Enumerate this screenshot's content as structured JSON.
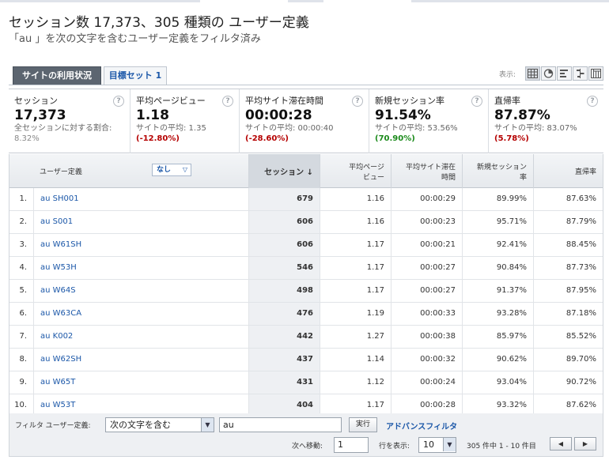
{
  "page": {
    "title": "セッション数 17,373、305 種類の ユーザー定義",
    "subtitle": "「au 」を次の文字を含むユーザー定義をフィルタ済み"
  },
  "tabs": [
    {
      "label": "サイトの利用状況",
      "active": true
    },
    {
      "label": "目標セット 1",
      "active": false
    }
  ],
  "views": {
    "label": "表示:",
    "icons": [
      "table-view-icon",
      "pie-view-icon",
      "performance-view-icon",
      "comparison-view-icon",
      "pivot-view-icon"
    ]
  },
  "scorecards": [
    {
      "label": "セッション",
      "value": "17,373",
      "sub": "全セッションに対する割合:",
      "delta": "8.32%",
      "delta_type": "plain"
    },
    {
      "label": "平均ページビュー",
      "value": "1.18",
      "sub": "サイトの平均: 1.35",
      "delta": "(-12.80%)",
      "delta_type": "neg"
    },
    {
      "label": "平均サイト滞在時間",
      "value": "00:00:28",
      "sub": "サイトの平均: 00:00:40",
      "delta": "(-28.60%)",
      "delta_type": "neg"
    },
    {
      "label": "新規セッション率",
      "value": "91.54%",
      "sub": "サイトの平均: 53.56%",
      "delta": "(70.90%)",
      "delta_type": "pos"
    },
    {
      "label": "直帰率",
      "value": "87.87%",
      "sub": "サイトの平均: 83.07%",
      "delta": "(5.78%)",
      "delta_type": "neg"
    }
  ],
  "table": {
    "dimension_label": "ユーザー定義",
    "segment_label": "なし",
    "headers": {
      "sessions": "セッション ↓",
      "pageviews": "平均ページ\nビュー",
      "duration": "平均サイト滞在\n時間",
      "new_rate": "新規セッション\n率",
      "bounce": "直帰率"
    },
    "rows": [
      {
        "idx": "1.",
        "name": "au SH001",
        "sessions": "679",
        "pv": "1.16",
        "dur": "00:00:29",
        "new": "89.99%",
        "bounce": "87.63%"
      },
      {
        "idx": "2.",
        "name": "au S001",
        "sessions": "606",
        "pv": "1.16",
        "dur": "00:00:23",
        "new": "95.71%",
        "bounce": "87.79%"
      },
      {
        "idx": "3.",
        "name": "au W61SH",
        "sessions": "606",
        "pv": "1.17",
        "dur": "00:00:21",
        "new": "92.41%",
        "bounce": "88.45%"
      },
      {
        "idx": "4.",
        "name": "au W53H",
        "sessions": "546",
        "pv": "1.17",
        "dur": "00:00:27",
        "new": "90.84%",
        "bounce": "87.73%"
      },
      {
        "idx": "5.",
        "name": "au W64S",
        "sessions": "498",
        "pv": "1.17",
        "dur": "00:00:27",
        "new": "91.37%",
        "bounce": "87.95%"
      },
      {
        "idx": "6.",
        "name": "au W63CA",
        "sessions": "476",
        "pv": "1.19",
        "dur": "00:00:33",
        "new": "93.28%",
        "bounce": "87.18%"
      },
      {
        "idx": "7.",
        "name": "au K002",
        "sessions": "442",
        "pv": "1.27",
        "dur": "00:00:38",
        "new": "85.97%",
        "bounce": "85.52%"
      },
      {
        "idx": "8.",
        "name": "au W62SH",
        "sessions": "437",
        "pv": "1.14",
        "dur": "00:00:32",
        "new": "90.62%",
        "bounce": "89.70%"
      },
      {
        "idx": "9.",
        "name": "au W65T",
        "sessions": "431",
        "pv": "1.12",
        "dur": "00:00:24",
        "new": "93.04%",
        "bounce": "90.72%"
      },
      {
        "idx": "10.",
        "name": "au W53T",
        "sessions": "404",
        "pv": "1.17",
        "dur": "00:00:28",
        "new": "93.32%",
        "bounce": "87.62%"
      }
    ]
  },
  "filter": {
    "label": "フィルタ ユーザー定義:",
    "match_type": "次の文字を含む",
    "value": "au",
    "apply_label": "実行",
    "advanced_label": "アドバンスフィルタ",
    "goto_label": "次へ移動:",
    "goto_value": "1",
    "rows_label": "行を表示:",
    "rows_value": "10",
    "range_text": "305 件中 1 - 10 件目",
    "prev_icon": "◀",
    "next_icon": "▶"
  }
}
